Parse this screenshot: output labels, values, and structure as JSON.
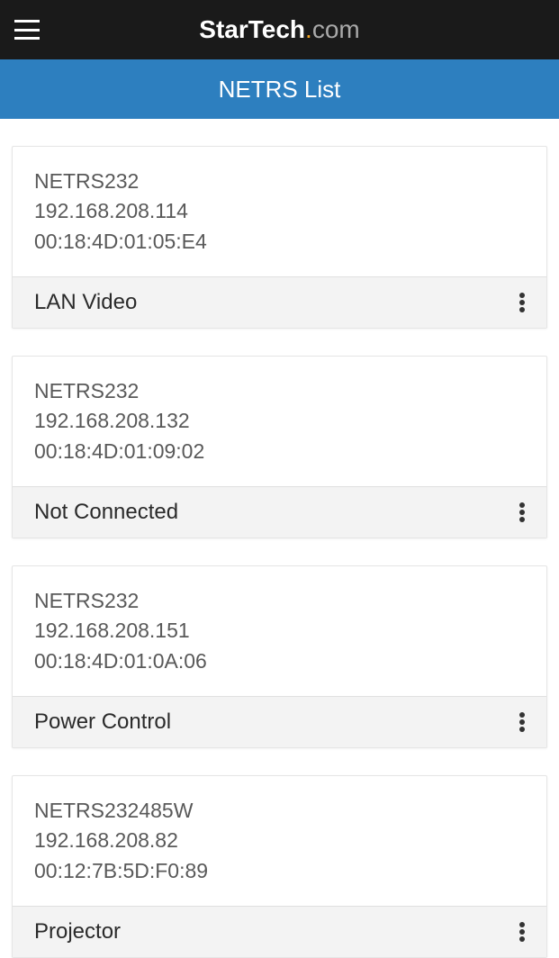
{
  "brand": {
    "part1": "Star",
    "part2": "Tech",
    "dot": ".",
    "part3": "com"
  },
  "pageTitle": "NETRS List",
  "devices": [
    {
      "model": "NETRS232",
      "ip": "192.168.208.114",
      "mac": "00:18:4D:01:05:E4",
      "label": "LAN Video"
    },
    {
      "model": "NETRS232",
      "ip": "192.168.208.132",
      "mac": "00:18:4D:01:09:02",
      "label": "Not Connected"
    },
    {
      "model": "NETRS232",
      "ip": "192.168.208.151",
      "mac": "00:18:4D:01:0A:06",
      "label": "Power Control"
    },
    {
      "model": "NETRS232485W",
      "ip": "192.168.208.82",
      "mac": "00:12:7B:5D:F0:89",
      "label": "Projector"
    }
  ]
}
